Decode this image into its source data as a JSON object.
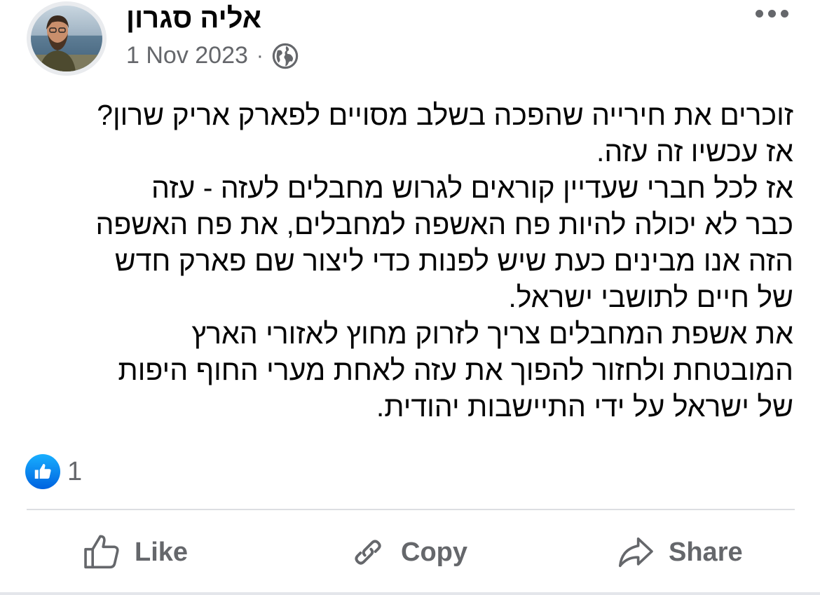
{
  "post": {
    "author": "אליה סגרון",
    "date": "1 Nov 2023",
    "separator": "·",
    "privacy_icon": "globe-icon",
    "menu_icon": "more-horizontal-icon",
    "text_lines": [
      "זוכרים את חירייה שהפכה בשלב מסויים לפארק אריק שרון?",
      "אז עכשיו זה עזה.",
      "אז לכל חברי שעדיין קוראים לגרוש מחבלים לעזה - עזה",
      "כבר לא יכולה להיות פח האשפה למחבלים, את פח האשפה",
      "הזה אנו מבינים כעת שיש לפנות כדי ליצור שם פארק חדש",
      "של חיים לתושבי ישראל.",
      "את אשפת המחבלים צריך לזרוק מחוץ לאזורי הארץ",
      "המובטחת ולחזור להפוך את עזה לאחת מערי החוף היפות",
      "של ישראל על ידי התיישבות יהודית."
    ]
  },
  "reactions": {
    "icon": "like-reaction-icon",
    "count": "1"
  },
  "actions": {
    "like_label": "Like",
    "copy_label": "Copy",
    "share_label": "Share"
  },
  "colors": {
    "text": "#050505",
    "secondary": "#65676b",
    "like_blue": "#0866ff",
    "divider": "#dcdee2"
  }
}
